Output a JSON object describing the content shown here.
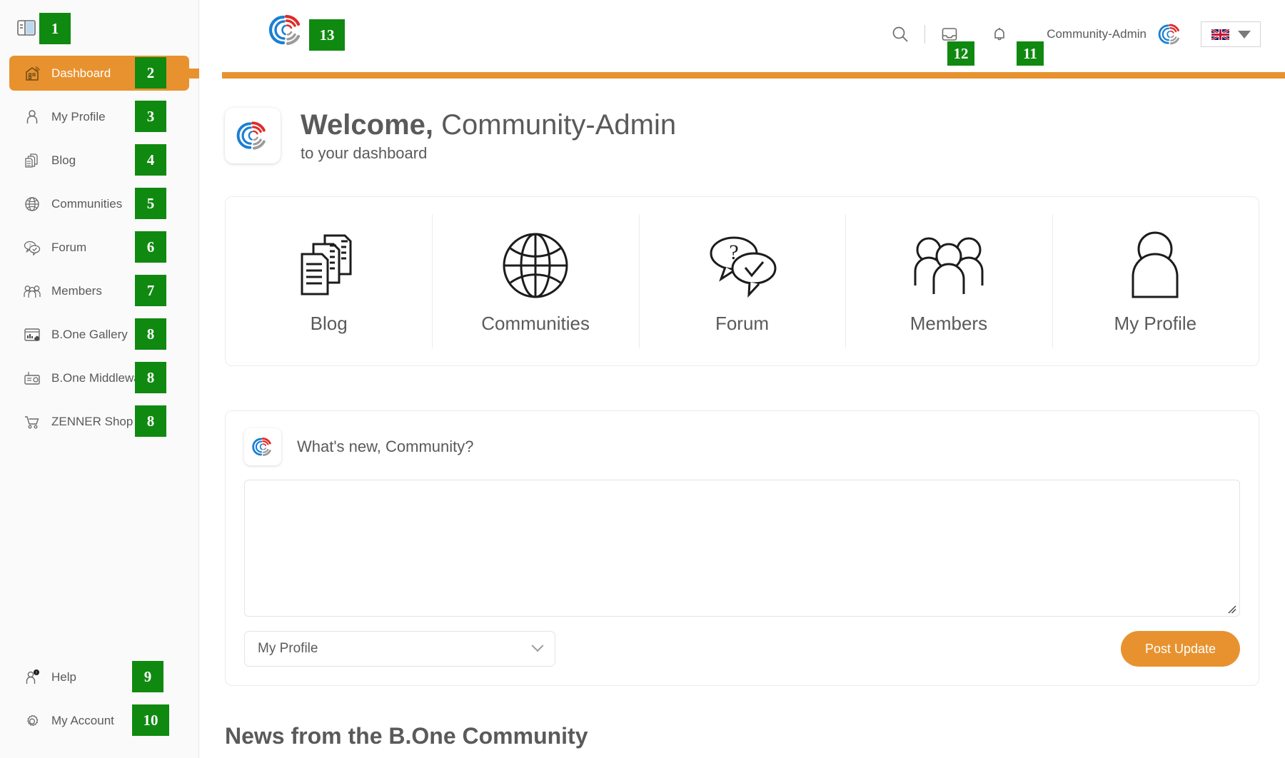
{
  "colors": {
    "accent_orange": "#e8922f",
    "badge_green": "#108910",
    "text_gray": "#5a5a5a",
    "sidebar_bg": "#fafafa",
    "logo_red": "#e02b28",
    "logo_blue": "#1b7fd4",
    "logo_gray": "#9b9b9b"
  },
  "sidebar": {
    "toggle_icon": "panel-toggle-icon",
    "toggle_badge": "1",
    "items": [
      {
        "label": "Dashboard",
        "icon": "dashboard-icon",
        "badge": "2",
        "active": true
      },
      {
        "label": "My Profile",
        "icon": "user-icon",
        "badge": "3",
        "active": false
      },
      {
        "label": "Blog",
        "icon": "documents-icon",
        "badge": "4",
        "active": false
      },
      {
        "label": "Communities",
        "icon": "globe-icon",
        "badge": "5",
        "active": false
      },
      {
        "label": "Forum",
        "icon": "speech-bubbles-icon",
        "badge": "6",
        "active": false
      },
      {
        "label": "Members",
        "icon": "people-group-icon",
        "badge": "7",
        "active": false
      },
      {
        "label": "B.One Gallery",
        "icon": "gallery-chart-icon",
        "badge": "8",
        "active": false
      },
      {
        "label": "B.One Middleware",
        "icon": "middleware-icon",
        "badge": "8",
        "active": false
      },
      {
        "label": "ZENNER Shop",
        "icon": "shopping-cart-icon",
        "badge": "8",
        "active": false
      }
    ],
    "bottom_items": [
      {
        "label": "Help",
        "icon": "user-help-icon",
        "badge": "9"
      },
      {
        "label": "My Account",
        "icon": "gear-icon",
        "badge": "10"
      }
    ]
  },
  "topbar": {
    "logo_icon": "bone-logo-icon",
    "logo_badge": "13",
    "search_icon": "search-icon",
    "search_badge": "12",
    "inbox_icon": "inbox-icon",
    "bell_icon": "bell-icon",
    "notifications_badge": "11",
    "username": "Community-Admin",
    "avatar_icon": "bone-avatar-icon",
    "language_flag": "uk-flag-icon",
    "language_caret": "chevron-down-icon"
  },
  "welcome": {
    "logo_icon": "bone-logo-icon",
    "greeting": "Welcome,",
    "name": "Community-Admin",
    "subtitle": "to your dashboard"
  },
  "nav_cards": [
    {
      "label": "Blog",
      "icon": "documents-icon"
    },
    {
      "label": "Communities",
      "icon": "globe-icon"
    },
    {
      "label": "Forum",
      "icon": "speech-bubbles-icon"
    },
    {
      "label": "Members",
      "icon": "people-group-icon"
    },
    {
      "label": "My Profile",
      "icon": "user-icon"
    }
  ],
  "post_box": {
    "avatar_icon": "bone-avatar-icon",
    "prompt": "What's new, Community?",
    "textarea_value": "",
    "textarea_placeholder": "",
    "audience_value": "My Profile",
    "audience_caret": "chevron-down-icon",
    "submit_label": "Post Update",
    "resize_icon": "resize-grip-icon"
  },
  "news": {
    "heading": "News from the B.One Community"
  }
}
